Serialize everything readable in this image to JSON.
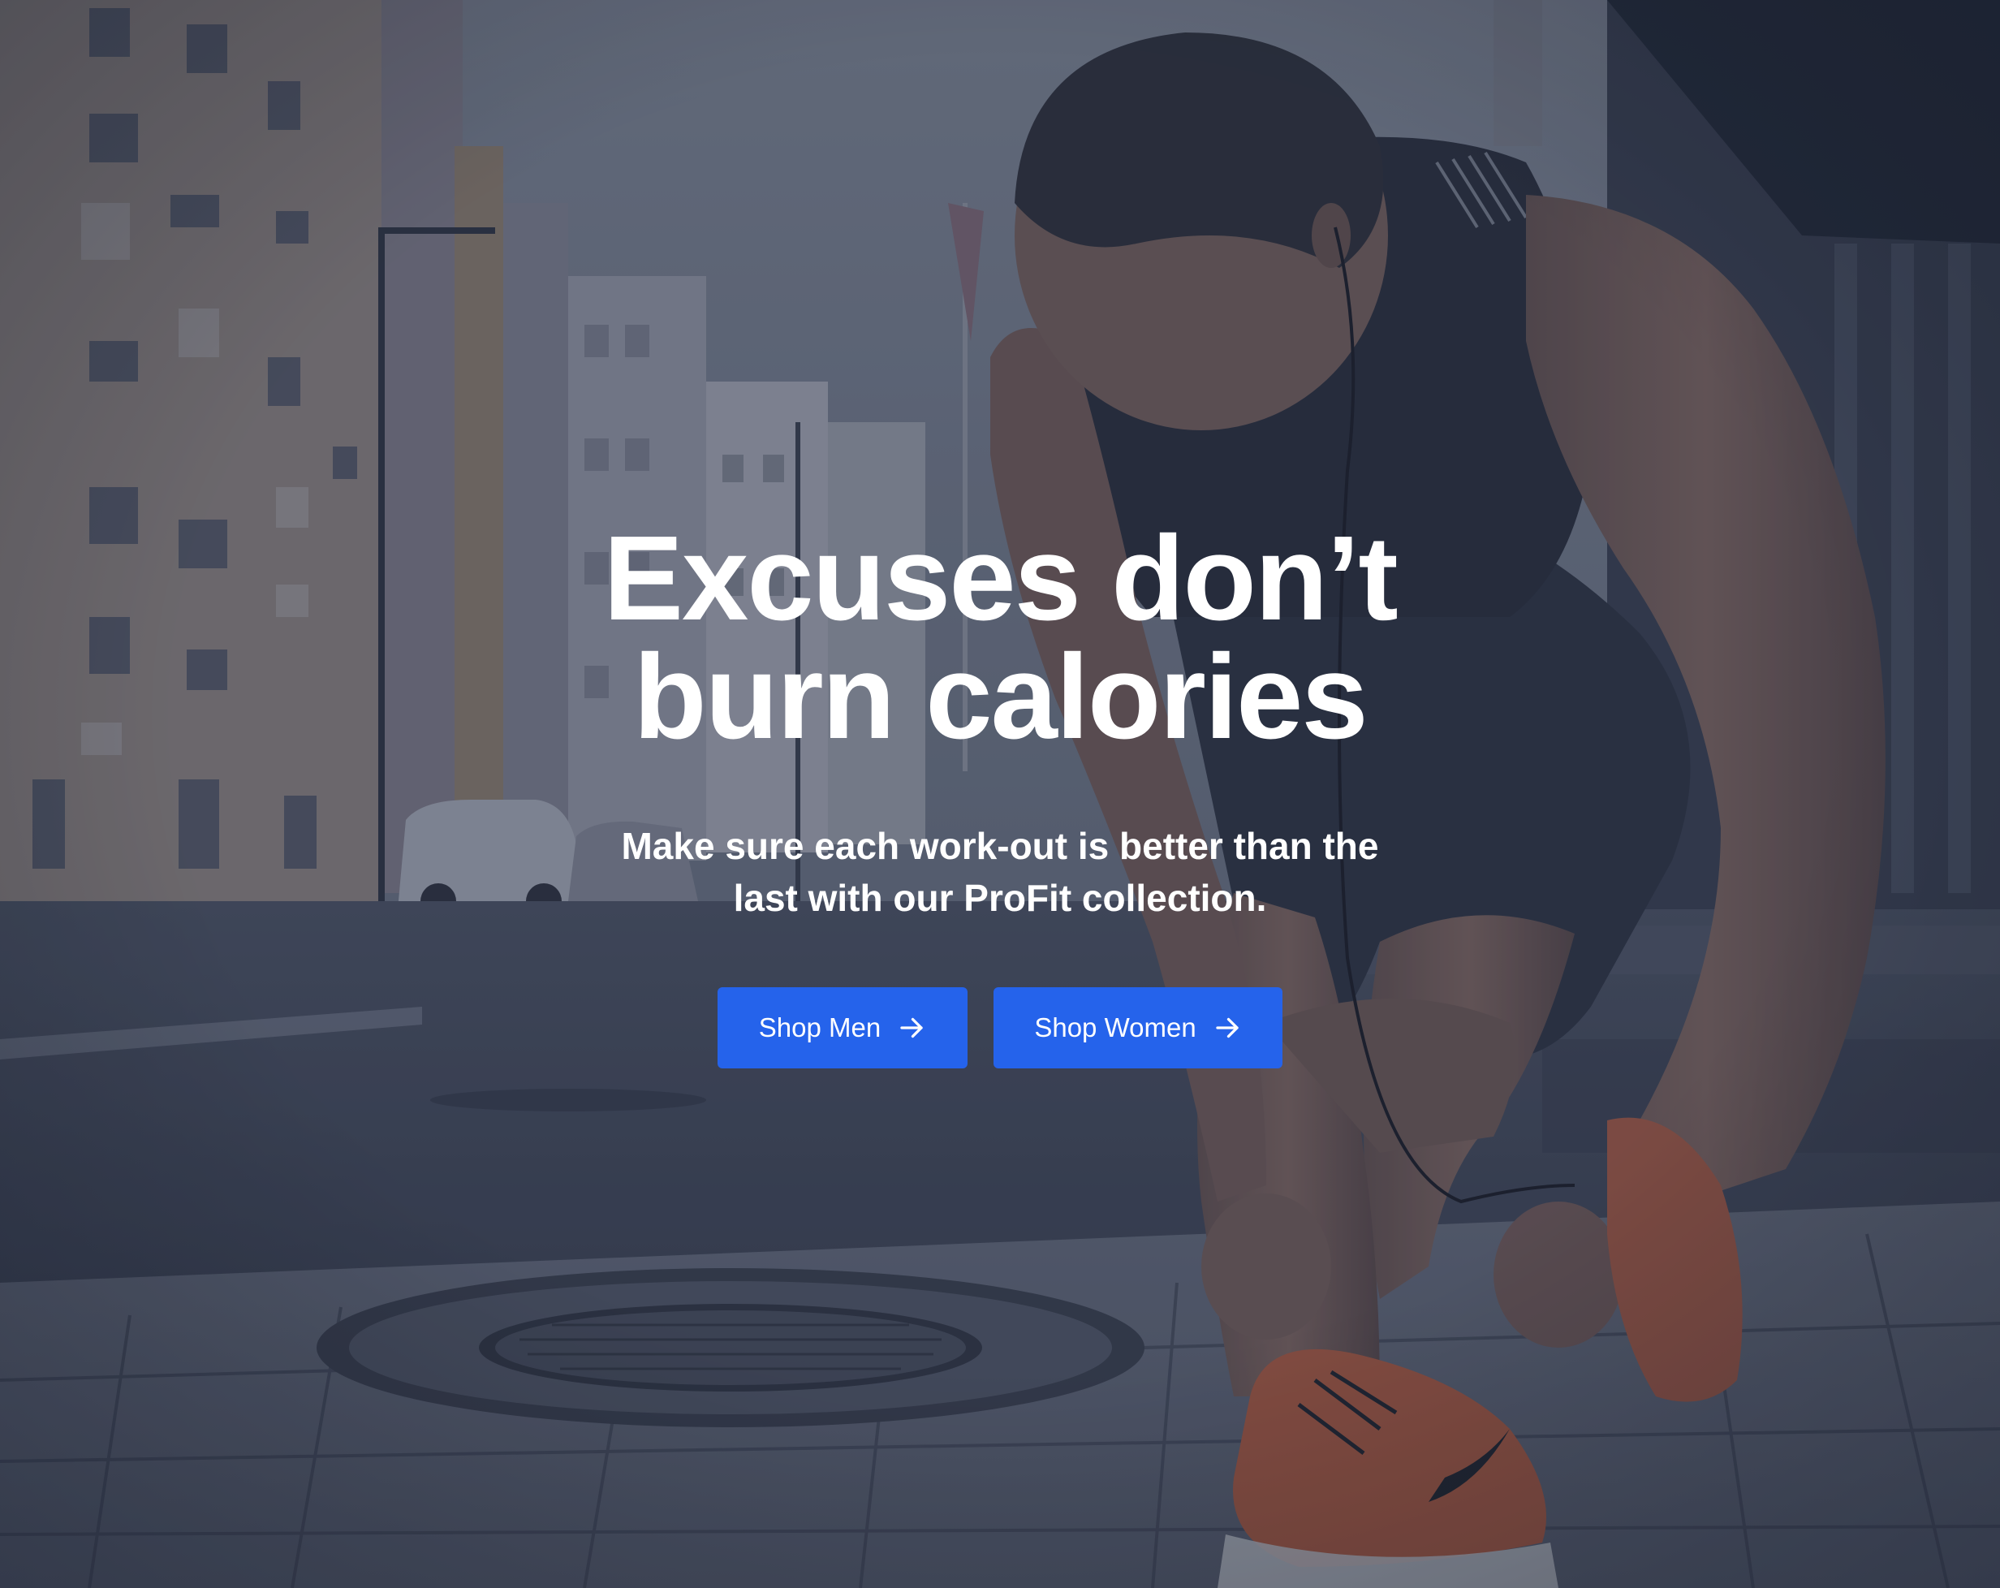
{
  "hero": {
    "headline_line1": "Excuses don’t",
    "headline_line2": "burn calories",
    "subtext_line1": "Make sure each work-out is better than the",
    "subtext_line2": "last with our ProFit collection.",
    "button_men_label": "Shop Men",
    "button_women_label": "Shop Women"
  },
  "colors": {
    "button_bg": "#2563eb",
    "text": "#ffffff",
    "overlay": "#242c40"
  },
  "icons": {
    "button_icon": "arrow-right-icon"
  }
}
